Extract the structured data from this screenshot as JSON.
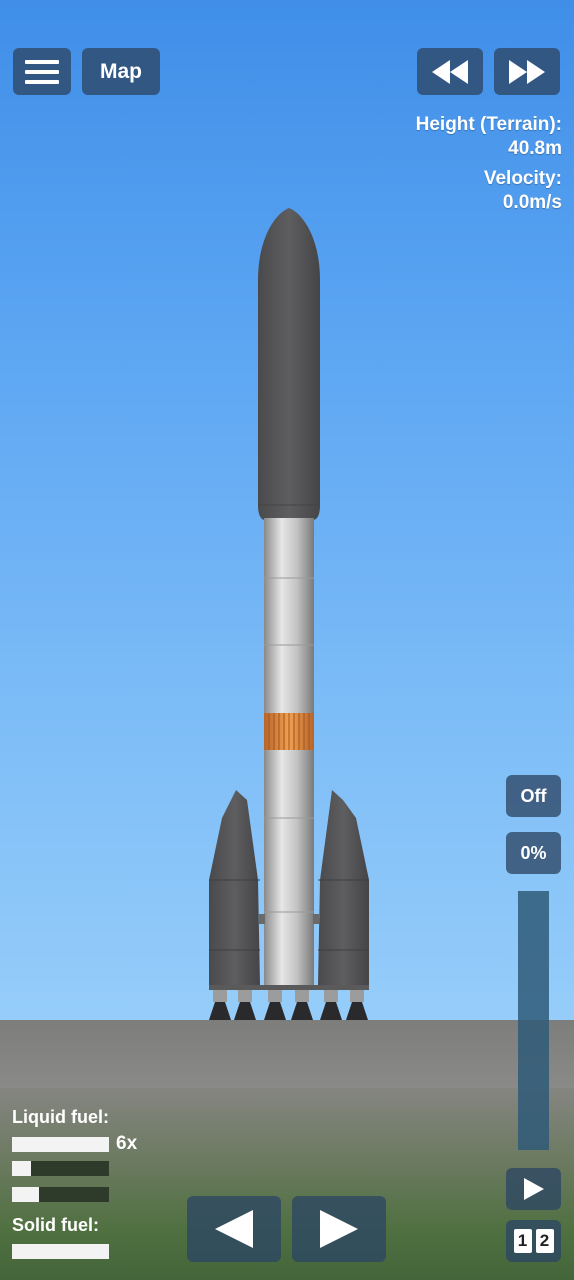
{
  "hud": {
    "menu_icon": "hamburger-menu-icon",
    "map_label": "Map",
    "rewind_icon": "rewind-icon",
    "fast_forward_icon": "fast-forward-icon"
  },
  "telemetry": {
    "height_label": "Height (Terrain):",
    "height_value": "40.8m",
    "velocity_label": "Velocity:",
    "velocity_value": "0.0m/s"
  },
  "controls": {
    "engine_toggle": "Off",
    "throttle_percent": "0%",
    "throttle_level": 0,
    "play_icon": "play-icon",
    "stage_digits": [
      "1",
      "2"
    ],
    "steer_left_icon": "left-arrow-icon",
    "steer_right_icon": "right-arrow-icon"
  },
  "fuel": {
    "liquid_label": "Liquid fuel:",
    "liquid_multiplier": "6x",
    "liquid_levels": [
      1.0,
      0.2,
      0.28
    ],
    "solid_label": "Solid fuel:",
    "solid_levels": [
      1.0
    ]
  },
  "colors": {
    "rocket_body": "#58585a",
    "core_stage": "#b4b4b4",
    "interstage": "#e08a3a",
    "hud_button": "#2d4664"
  }
}
